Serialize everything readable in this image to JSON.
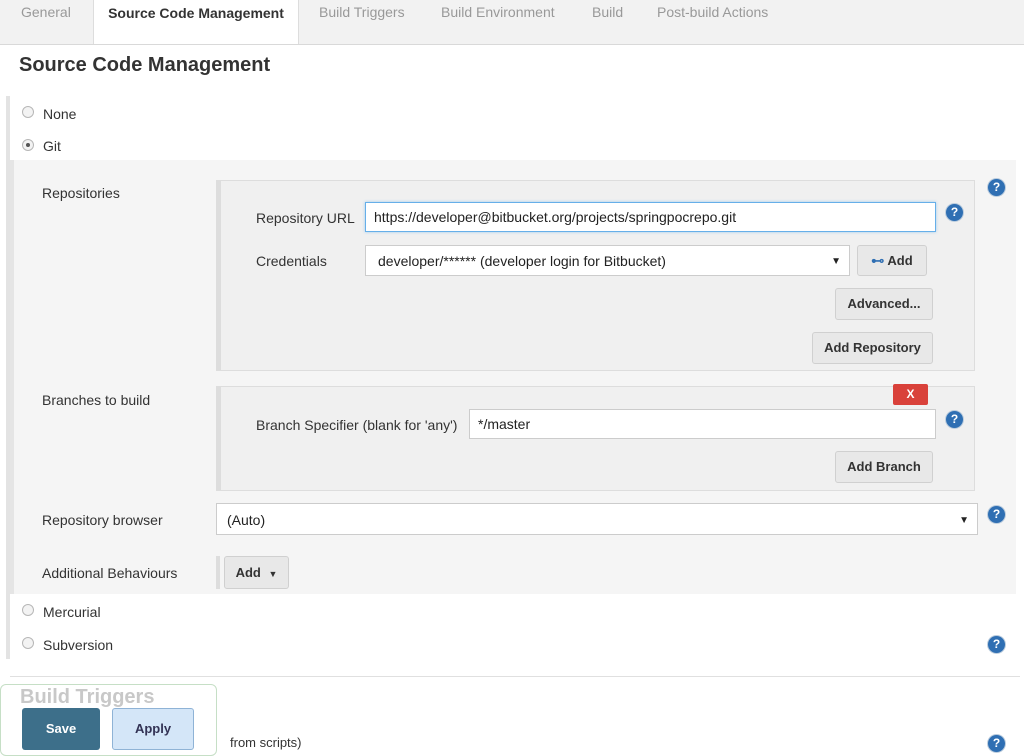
{
  "tabs": [
    "General",
    "Source Code Management",
    "Build Triggers",
    "Build Environment",
    "Build",
    "Post-build Actions"
  ],
  "section_title": "Source Code Management",
  "scm_options": {
    "none": "None",
    "git": "Git",
    "mercurial": "Mercurial",
    "subversion": "Subversion"
  },
  "git": {
    "repositories_label": "Repositories",
    "repo_url_label": "Repository URL",
    "repo_url_value": "https://developer@bitbucket.org/projects/springpocrepo.git",
    "credentials_label": "Credentials",
    "credentials_value": "developer/****** (developer login for Bitbucket)",
    "add_credentials_label": "Add",
    "advanced_label": "Advanced...",
    "add_repository_label": "Add Repository",
    "branches_label": "Branches to build",
    "remove_branch_label": "X",
    "branch_specifier_label": "Branch Specifier (blank for 'any')",
    "branch_specifier_value": "*/master",
    "add_branch_label": "Add Branch",
    "repo_browser_label": "Repository browser",
    "repo_browser_value": "(Auto)",
    "additional_behaviours_label": "Additional Behaviours",
    "add_behaviour_label": "Add"
  },
  "help_glyph": "?",
  "footer": {
    "build_triggers_heading": "Build Triggers",
    "save_label": "Save",
    "apply_label": "Apply",
    "partial_text": "from scripts)"
  },
  "colors": {
    "save_bg": "#3d6f8a",
    "apply_bg": "#d4e6f8",
    "help_bg": "#2f6fb3",
    "remove_bg": "#d9413a"
  }
}
